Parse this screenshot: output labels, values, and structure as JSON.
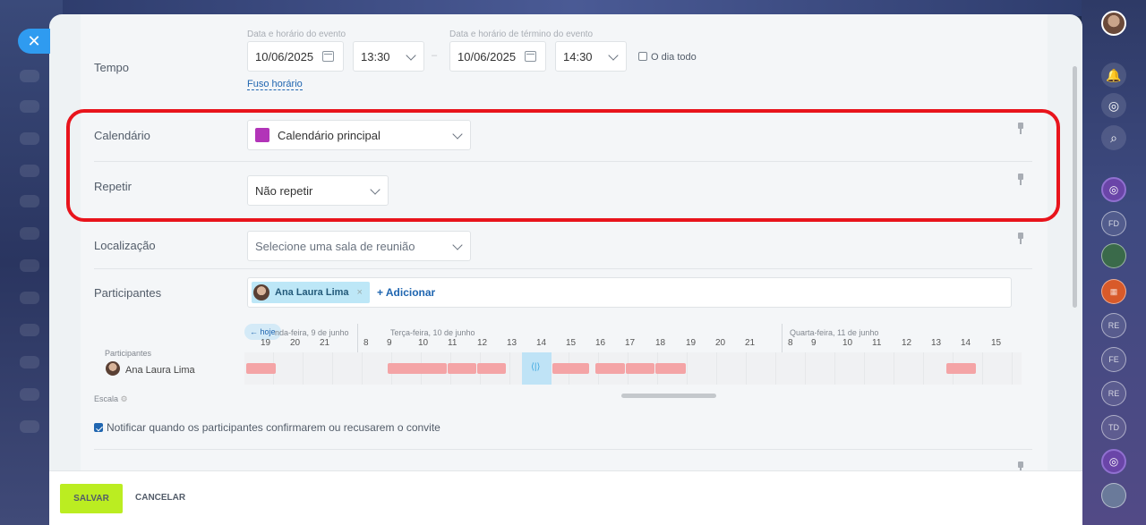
{
  "time": {
    "label": "Tempo",
    "start_caption": "Data e horário do evento",
    "end_caption": "Data e horário de término do evento",
    "start_date": "10/06/2025",
    "start_time": "13:30",
    "end_date": "10/06/2025",
    "end_time": "14:30",
    "dash": "–",
    "all_day": "O dia todo",
    "timezone_link": "Fuso horário"
  },
  "calendar": {
    "label": "Calendário",
    "value": "Calendário principal",
    "color": "#b234b8"
  },
  "repeat": {
    "label": "Repetir",
    "value": "Não repetir"
  },
  "location": {
    "label": "Localização",
    "placeholder": "Selecione uma sala de reunião"
  },
  "participants": {
    "label": "Participantes",
    "chip_name": "Ana Laura Lima",
    "chip_remove": "×",
    "add_link": "+ Adicionar"
  },
  "planner": {
    "today_button": "← hoje",
    "day1": "nda-feira, 9 de junho",
    "day2": "Terça-feira, 10 de junho",
    "day3": "Quarta-feira, 11 de junho",
    "participants_header": "Participantes",
    "participant_name": "Ana Laura Lima",
    "scale_label": "Escala",
    "now_marker": "⟨|⟩",
    "hours": [
      "19",
      "20",
      "21",
      "8",
      "9",
      "10",
      "11",
      "12",
      "13",
      "14",
      "15",
      "16",
      "17",
      "18",
      "19",
      "20",
      "21",
      "8",
      "9",
      "10",
      "11",
      "12",
      "13",
      "14",
      "15"
    ]
  },
  "notify": {
    "label": "Notificar quando os participantes confirmarem ou recusarem o convite",
    "checked": true
  },
  "footer": {
    "save": "SALVAR",
    "cancel": "CANCELAR"
  },
  "rail": [
    "FD",
    "RE",
    "FE",
    "RE",
    "TD"
  ],
  "colors": {
    "accent": "#2f9bf0",
    "save": "#bbed21",
    "busy": "#f4a4a6",
    "highlight": "#e8141c"
  }
}
